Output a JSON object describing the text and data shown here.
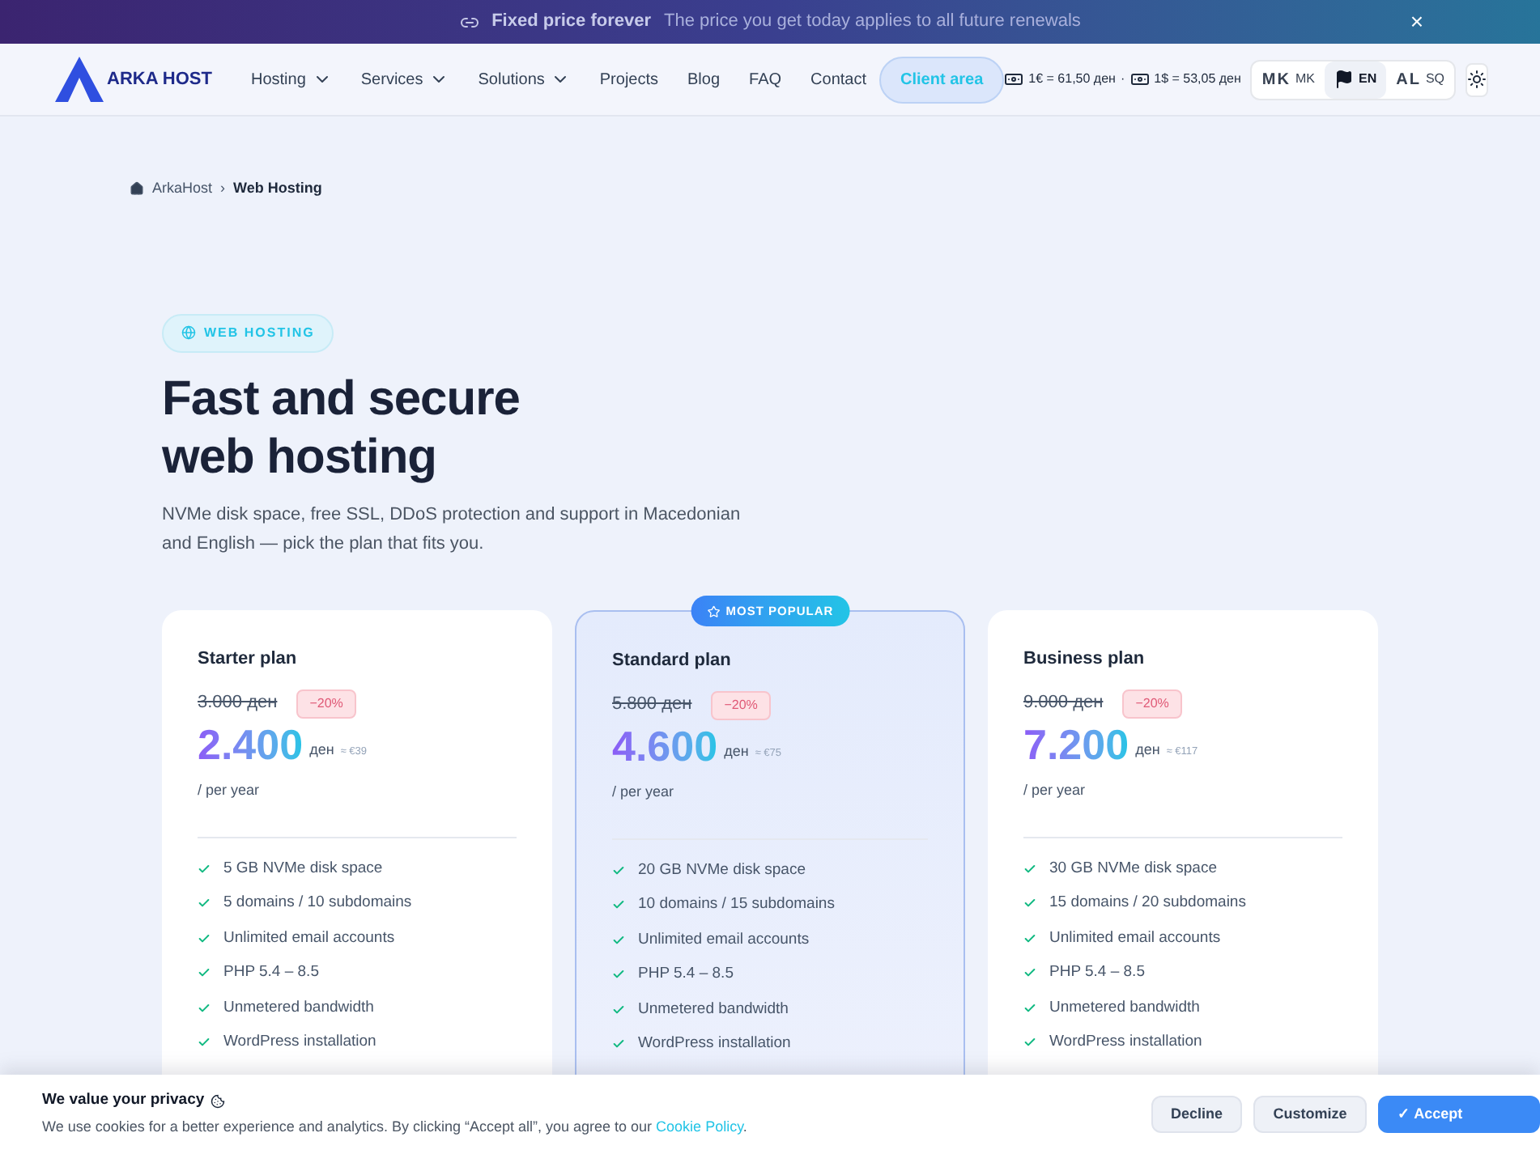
{
  "announcement": {
    "title": "Fixed price forever",
    "text": "The price you get today applies to all future renewals",
    "close": "×"
  },
  "header": {
    "logo": "ARKA HOST",
    "nav": [
      {
        "label": "Hosting",
        "dropdown": true
      },
      {
        "label": "Services",
        "dropdown": true
      },
      {
        "label": "Solutions",
        "dropdown": true
      },
      {
        "label": "Projects",
        "dropdown": false
      },
      {
        "label": "Blog",
        "dropdown": false
      },
      {
        "label": "FAQ",
        "dropdown": false
      },
      {
        "label": "Contact",
        "dropdown": false
      }
    ],
    "client_area": "Client area",
    "rates": [
      "1€ = 61,50 ден",
      "1$ = 53,05 ден"
    ],
    "rate_separator": "·",
    "languages": [
      {
        "flag": "MK",
        "label": "MK",
        "selected": false
      },
      {
        "label": "EN",
        "selected": true
      },
      {
        "flag": "AL",
        "label": "SQ",
        "selected": false
      }
    ]
  },
  "breadcrumb": [
    {
      "label": "ArkaHost",
      "current": false
    },
    {
      "label": "Web Hosting",
      "current": true
    }
  ],
  "breadcrumb_separator": "›",
  "hero": {
    "badge": "WEB HOSTING",
    "title_lines": [
      "Fast and secure",
      "web hosting"
    ],
    "subtitle": "NVMe disk space, free SSL, DDoS protection and support in Macedonian and English — pick the plan that fits you."
  },
  "plans": [
    {
      "name": "Starter plan",
      "popular": false,
      "old_price": "3.000 ден",
      "discount": "−20%",
      "price": "2.400",
      "currency": "ден",
      "approx": "≈ €39",
      "period": "/ per year",
      "features": [
        "5 GB NVMe disk space",
        "5 domains / 10 subdomains",
        "Unlimited email accounts",
        "PHP 5.4 – 8.5",
        "Unmetered bandwidth",
        "WordPress installation"
      ]
    },
    {
      "name": "Standard plan",
      "popular": true,
      "badge": "MOST POPULAR",
      "old_price": "5.800 ден",
      "discount": "−20%",
      "price": "4.600",
      "currency": "ден",
      "approx": "≈ €75",
      "period": "/ per year",
      "features": [
        "20 GB NVMe disk space",
        "10 domains / 15 subdomains",
        "Unlimited email accounts",
        "PHP 5.4 – 8.5",
        "Unmetered bandwidth",
        "WordPress installation"
      ]
    },
    {
      "name": "Business plan",
      "popular": false,
      "old_price": "9.000 ден",
      "discount": "−20%",
      "price": "7.200",
      "currency": "ден",
      "approx": "≈ €117",
      "period": "/ per year",
      "features": [
        "30 GB NVMe disk space",
        "15 domains / 20 subdomains",
        "Unlimited email accounts",
        "PHP 5.4 – 8.5",
        "Unmetered bandwidth",
        "WordPress installation"
      ]
    }
  ],
  "cookie_banner": {
    "title": "We value your privacy",
    "text": "We use cookies for a better experience and analytics. By clicking “Accept all”, you agree to our",
    "link": "Cookie Policy",
    "after_link": ".",
    "buttons": [
      {
        "label": "Decline",
        "kind": "secondary"
      },
      {
        "label": "Customize",
        "kind": "secondary"
      },
      {
        "label": "✓ Accept",
        "kind": "primary"
      }
    ]
  }
}
